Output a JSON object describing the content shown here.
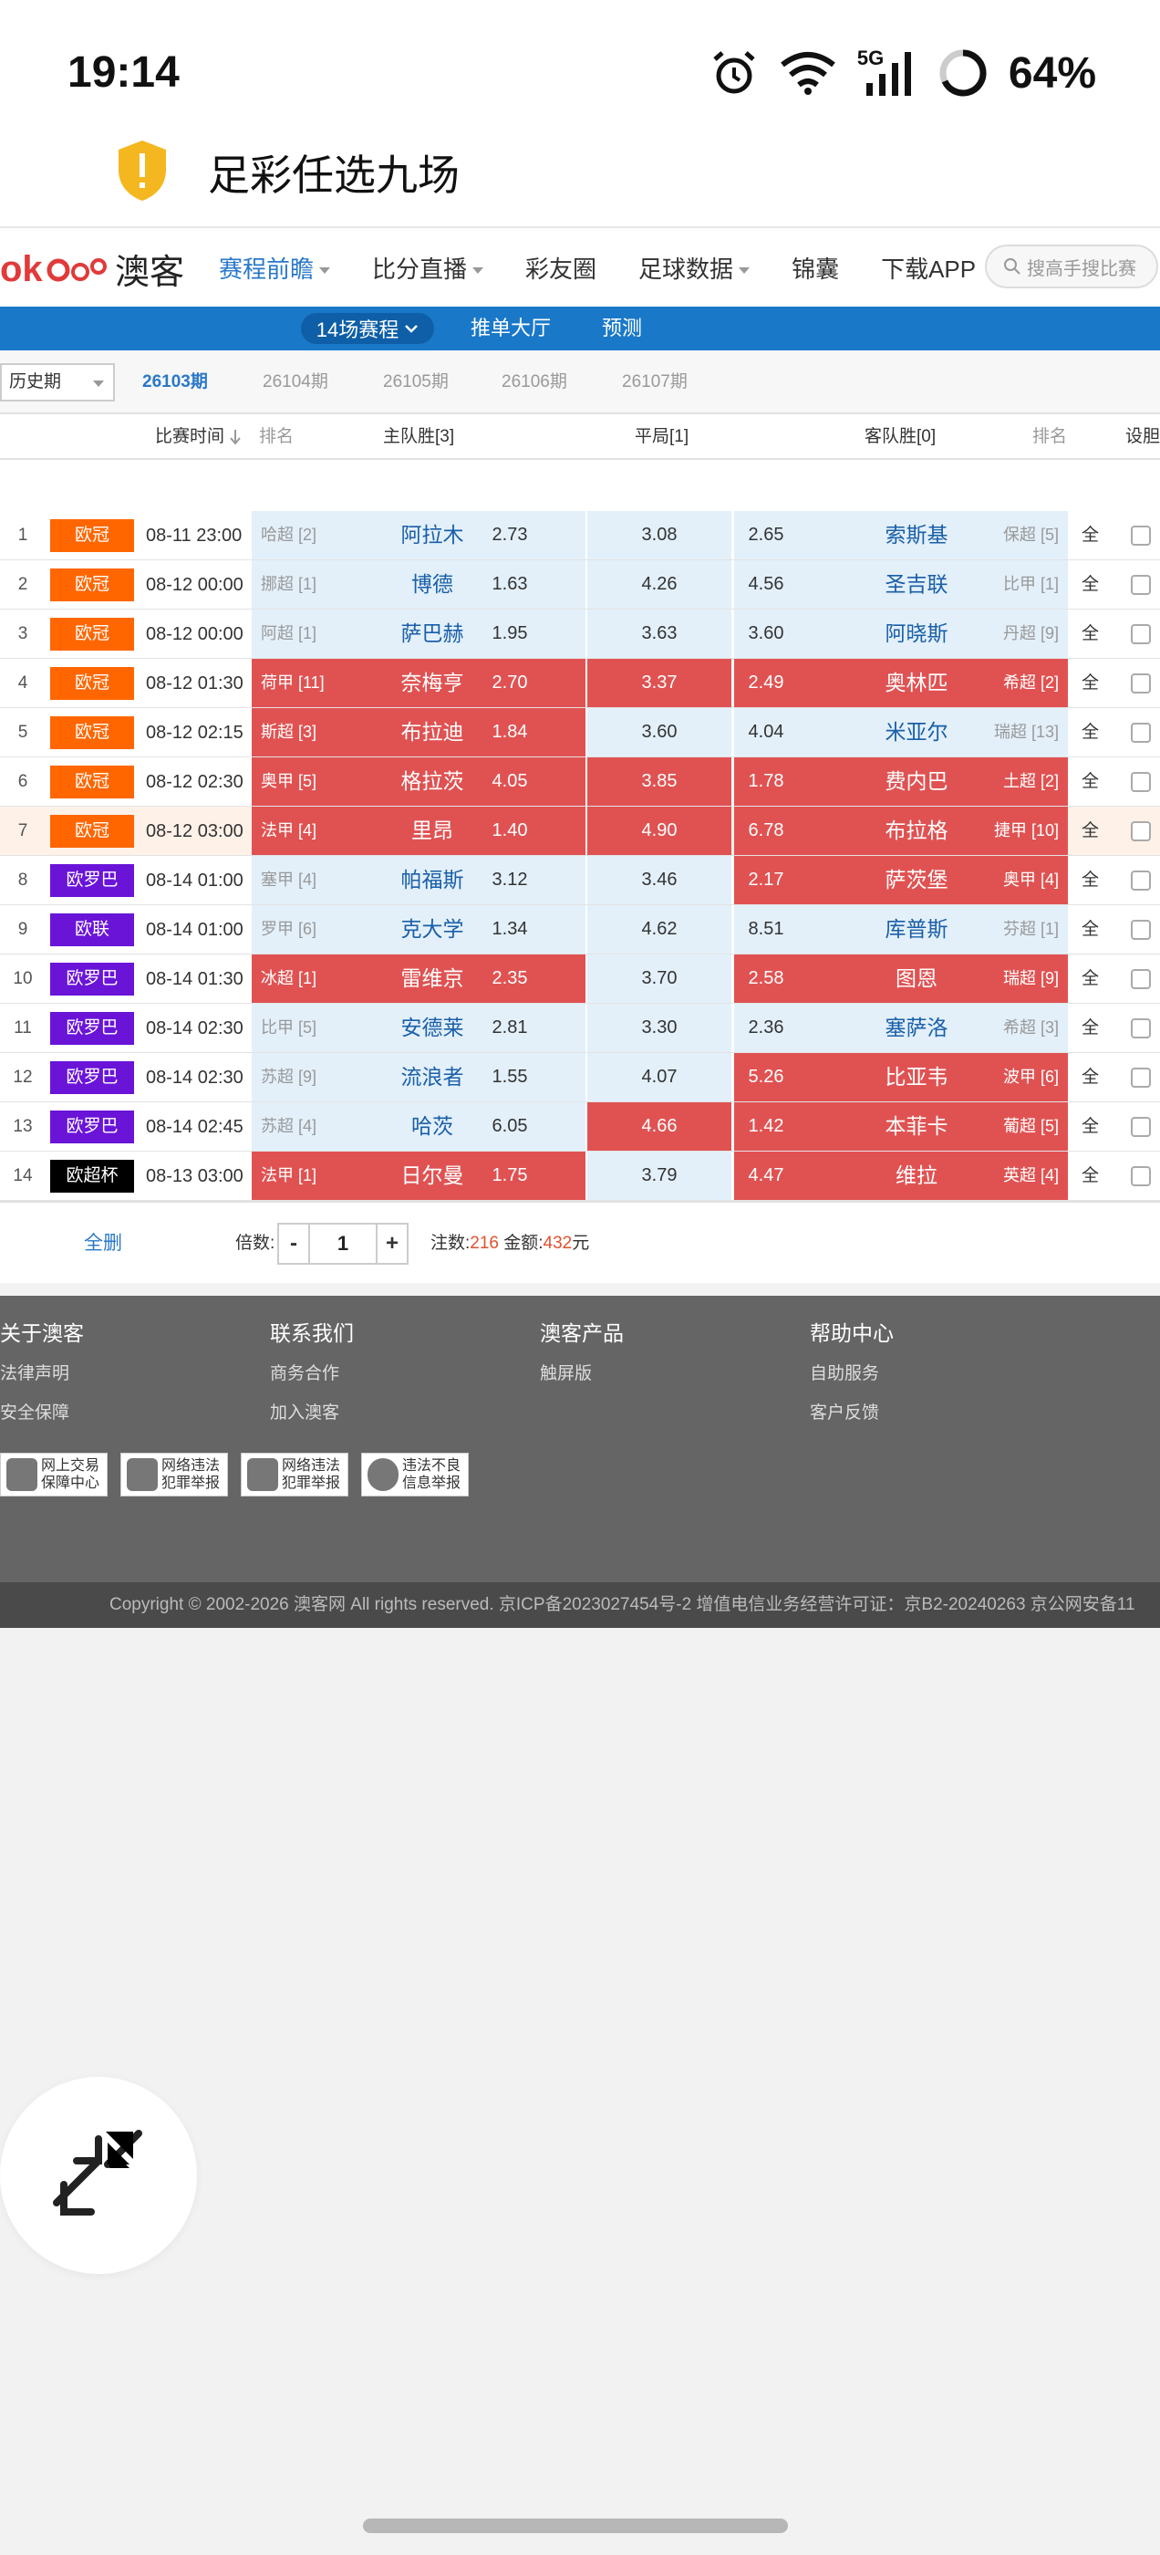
{
  "status_bar": {
    "time": "19:14",
    "network": "5G",
    "battery": "64%",
    "icons": [
      "alarm-icon",
      "wifi-icon",
      "signal-icon",
      "battery-ring-icon"
    ]
  },
  "header": {
    "title": "足彩任选九场",
    "icon": "shield-alert-icon"
  },
  "nav": {
    "logo_text": "澳客",
    "items": [
      "赛程前瞻",
      "比分直播",
      "彩友圈",
      "足球数据",
      "锦囊",
      "下载APP"
    ],
    "search_placeholder": "搜高手搜比赛"
  },
  "subnav": {
    "selected": "14场赛程",
    "links": [
      "推单大厅",
      "预测"
    ]
  },
  "periods": {
    "history_select": "历史期",
    "items": [
      "26103期",
      "26104期",
      "26105期",
      "26106期",
      "26107期"
    ],
    "active": "26103期"
  },
  "table_header": {
    "time": "比赛时间",
    "rank_left": "排名",
    "home": "主队胜[3]",
    "draw": "平局[1]",
    "away": "客队胜[0]",
    "rank_right": "排名",
    "set": "设胆"
  },
  "matches": [
    {
      "idx": "1",
      "league": "欧冠",
      "league_color": "#ff6600",
      "time": "08-11 23:00",
      "home_rank": "哈超 [2]",
      "home": "阿拉木",
      "home_odd": "2.73",
      "draw_odd": "3.08",
      "away_odd": "2.65",
      "away": "索斯基",
      "away_rank": "保超 [5]",
      "all": "全",
      "sel": [
        false,
        false,
        false
      ],
      "highlight": false
    },
    {
      "idx": "2",
      "league": "欧冠",
      "league_color": "#ff6600",
      "time": "08-12 00:00",
      "home_rank": "挪超 [1]",
      "home": "博德",
      "home_odd": "1.63",
      "draw_odd": "4.26",
      "away_odd": "4.56",
      "away": "圣吉联",
      "away_rank": "比甲 [1]",
      "all": "全",
      "sel": [
        false,
        false,
        false
      ],
      "highlight": false
    },
    {
      "idx": "3",
      "league": "欧冠",
      "league_color": "#ff6600",
      "time": "08-12 00:00",
      "home_rank": "阿超 [1]",
      "home": "萨巴赫",
      "home_odd": "1.95",
      "draw_odd": "3.63",
      "away_odd": "3.60",
      "away": "阿晓斯",
      "away_rank": "丹超 [9]",
      "all": "全",
      "sel": [
        false,
        false,
        false
      ],
      "highlight": false
    },
    {
      "idx": "4",
      "league": "欧冠",
      "league_color": "#ff6600",
      "time": "08-12 01:30",
      "home_rank": "荷甲 [11]",
      "home": "奈梅亨",
      "home_odd": "2.70",
      "draw_odd": "3.37",
      "away_odd": "2.49",
      "away": "奥林匹",
      "away_rank": "希超 [2]",
      "all": "全",
      "sel": [
        true,
        true,
        true
      ],
      "highlight": false
    },
    {
      "idx": "5",
      "league": "欧冠",
      "league_color": "#ff6600",
      "time": "08-12 02:15",
      "home_rank": "斯超 [3]",
      "home": "布拉迪",
      "home_odd": "1.84",
      "draw_odd": "3.60",
      "away_odd": "4.04",
      "away": "米亚尔",
      "away_rank": "瑞超 [13]",
      "all": "全",
      "sel": [
        true,
        false,
        false
      ],
      "highlight": false
    },
    {
      "idx": "6",
      "league": "欧冠",
      "league_color": "#ff6600",
      "time": "08-12 02:30",
      "home_rank": "奥甲 [5]",
      "home": "格拉茨",
      "home_odd": "4.05",
      "draw_odd": "3.85",
      "away_odd": "1.78",
      "away": "费内巴",
      "away_rank": "土超 [2]",
      "all": "全",
      "sel": [
        true,
        true,
        true
      ],
      "highlight": false
    },
    {
      "idx": "7",
      "league": "欧冠",
      "league_color": "#ff6600",
      "time": "08-12 03:00",
      "home_rank": "法甲 [4]",
      "home": "里昂",
      "home_odd": "1.40",
      "draw_odd": "4.90",
      "away_odd": "6.78",
      "away": "布拉格",
      "away_rank": "捷甲 [10]",
      "all": "全",
      "sel": [
        true,
        true,
        true
      ],
      "highlight": true
    },
    {
      "idx": "8",
      "league": "欧罗巴",
      "league_color": "#6a14d8",
      "time": "08-14 01:00",
      "home_rank": "塞甲 [4]",
      "home": "帕福斯",
      "home_odd": "3.12",
      "draw_odd": "3.46",
      "away_odd": "2.17",
      "away": "萨茨堡",
      "away_rank": "奥甲 [4]",
      "all": "全",
      "sel": [
        false,
        false,
        true
      ],
      "highlight": false
    },
    {
      "idx": "9",
      "league": "欧联",
      "league_color": "#6a14d8",
      "time": "08-14 01:00",
      "home_rank": "罗甲 [6]",
      "home": "克大学",
      "home_odd": "1.34",
      "draw_odd": "4.62",
      "away_odd": "8.51",
      "away": "库普斯",
      "away_rank": "芬超 [1]",
      "all": "全",
      "sel": [
        false,
        false,
        false
      ],
      "highlight": false
    },
    {
      "idx": "10",
      "league": "欧罗巴",
      "league_color": "#6a14d8",
      "time": "08-14 01:30",
      "home_rank": "冰超 [1]",
      "home": "雷维京",
      "home_odd": "2.35",
      "draw_odd": "3.70",
      "away_odd": "2.58",
      "away": "图恩",
      "away_rank": "瑞超 [9]",
      "all": "全",
      "sel": [
        true,
        false,
        true
      ],
      "highlight": false
    },
    {
      "idx": "11",
      "league": "欧罗巴",
      "league_color": "#6a14d8",
      "time": "08-14 02:30",
      "home_rank": "比甲 [5]",
      "home": "安德莱",
      "home_odd": "2.81",
      "draw_odd": "3.30",
      "away_odd": "2.36",
      "away": "塞萨洛",
      "away_rank": "希超 [3]",
      "all": "全",
      "sel": [
        false,
        false,
        false
      ],
      "highlight": false
    },
    {
      "idx": "12",
      "league": "欧罗巴",
      "league_color": "#6a14d8",
      "time": "08-14 02:30",
      "home_rank": "苏超 [9]",
      "home": "流浪者",
      "home_odd": "1.55",
      "draw_odd": "4.07",
      "away_odd": "5.26",
      "away": "比亚韦",
      "away_rank": "波甲 [6]",
      "all": "全",
      "sel": [
        false,
        false,
        true
      ],
      "highlight": false
    },
    {
      "idx": "13",
      "league": "欧罗巴",
      "league_color": "#6a14d8",
      "time": "08-14 02:45",
      "home_rank": "苏超 [4]",
      "home": "哈茨",
      "home_odd": "6.05",
      "draw_odd": "4.66",
      "away_odd": "1.42",
      "away": "本菲卡",
      "away_rank": "葡超 [5]",
      "all": "全",
      "sel": [
        false,
        true,
        true
      ],
      "highlight": false
    },
    {
      "idx": "14",
      "league": "欧超杯",
      "league_color": "#000000",
      "time": "08-13 03:00",
      "home_rank": "法甲 [1]",
      "home": "日尔曼",
      "home_odd": "1.75",
      "draw_odd": "3.79",
      "away_odd": "4.47",
      "away": "维拉",
      "away_rank": "英超 [4]",
      "all": "全",
      "sel": [
        true,
        false,
        true
      ],
      "highlight": false
    }
  ],
  "bet_bar": {
    "delete_all": "全删",
    "multiplier_label": "倍数:",
    "minus": "-",
    "multiplier": "1",
    "plus": "+",
    "count_label": "注数:",
    "count": "216",
    "amount_label": "金额:",
    "amount": "432",
    "amount_unit": "元"
  },
  "footer": {
    "columns": [
      {
        "title": "关于澳客",
        "links": [
          "法律声明",
          "安全保障"
        ]
      },
      {
        "title": "联系我们",
        "links": [
          "商务合作",
          "加入澳客"
        ]
      },
      {
        "title": "澳客产品",
        "links": [
          "触屏版"
        ]
      },
      {
        "title": "帮助中心",
        "links": [
          "自助服务",
          "客户反馈"
        ]
      }
    ],
    "badges": [
      "网上交易\n保障中心",
      "网络违法\n犯罪举报",
      "网络违法\n犯罪举报",
      "违法不良\n信息举报"
    ],
    "copyright": "Copyright © 2002-2026 澳客网  All rights reserved.    京ICP备2023027454号-2  增值电信业务经营许可证：京B2-20240263  京公网安备11"
  },
  "colors": {
    "accent": "#1a78c8",
    "selected_cell": "#e05252",
    "cell": "#e3f0fa",
    "league_cl": "#ff6600",
    "league_el": "#6a14d8"
  }
}
